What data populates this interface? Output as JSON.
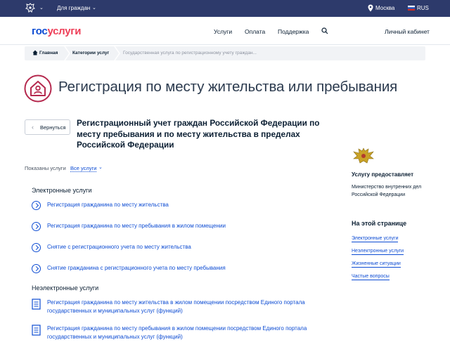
{
  "topbar": {
    "audience": "Для граждан",
    "city": "Москва",
    "language": "RUS"
  },
  "header": {
    "logo_part1": "гос",
    "logo_part2": "услуги",
    "nav": [
      "Услуги",
      "Оплата",
      "Поддержка"
    ],
    "cabinet": "Личный кабинет"
  },
  "breadcrumbs": {
    "home": "Главная",
    "category": "Категории услуг",
    "current": "Государственная услуга по регистрационному учету граждан..."
  },
  "page": {
    "title": "Регистрация по месту жительства или пребывания",
    "back": "Вернуться",
    "subtitle": "Регистрационный учет граждан Российской Федерации по месту пребывания и по месту жительства в пределах Российской Федерации",
    "filter_label": "Показаны услуги",
    "filter_value": "Все услуги"
  },
  "electronic": {
    "heading": "Электронные услуги",
    "items": [
      "Регистрация гражданина по месту жительства",
      "Регистрация гражданина по месту пребывания в жилом помещении",
      "Снятие с регистрационного учета по месту жительства",
      "Снятие гражданина с регистрационного учета по месту пребывания"
    ]
  },
  "non_electronic": {
    "heading": "Неэлектронные услуги",
    "items": [
      "Регистрация гражданина по месту жительства в жилом помещении посредством Единого портала государственных и муниципальных услуг (функций)",
      "Регистрация гражданина по месту пребывания в жилом помещении посредством Единого портала государственных и муниципальных услуг (функций)"
    ]
  },
  "sidebar": {
    "provider_heading": "Услугу предоставляет",
    "provider": "Министерство внутренних дел Российской Федерации",
    "on_page_heading": "На этой странице",
    "links": [
      "Электронные услуги",
      "Неэлектронные услуги",
      "Жизненные ситуации",
      "Частые вопросы"
    ]
  },
  "colors": {
    "topbar": "#2d3a6b",
    "link": "#0d4cd3",
    "accent": "#ee3f58",
    "title_icon": "#b5294e"
  },
  "icons": {
    "emblem": "russian-emblem-icon",
    "pin": "location-pin-icon",
    "flag": "russia-flag-icon",
    "search": "search-icon",
    "home": "home-icon",
    "service": "chevron-circle-icon",
    "document": "document-icon",
    "title": "house-person-icon"
  }
}
